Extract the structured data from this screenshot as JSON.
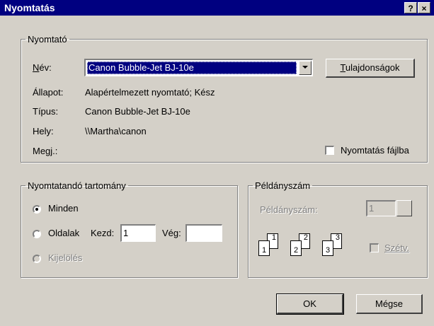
{
  "window": {
    "title": "Nyomtatás",
    "help_label": "?",
    "close_label": "×"
  },
  "printer": {
    "group_label": "Nyomtató",
    "name_label": "Név:",
    "name_value": "Canon Bubble-Jet BJ-10e",
    "properties_button": "Tulajdonságok",
    "status_label": "Állapot:",
    "status_value": "Alapértelmezett nyomtató; Kész",
    "type_label": "Típus:",
    "type_value": "Canon Bubble-Jet BJ-10e",
    "location_label": "Hely:",
    "location_value": "\\\\Martha\\canon",
    "comment_label": "Megj.:",
    "print_to_file_label": "Nyomtatás fájlba",
    "print_to_file_checked": false
  },
  "range": {
    "group_label": "Nyomtatandó tartomány",
    "all_label": "Minden",
    "pages_label": "Oldalak",
    "from_label": "Kezd:",
    "from_value": "1",
    "to_label": "Vég:",
    "to_value": "",
    "selection_label": "Kijelölés",
    "selected": "all"
  },
  "copies": {
    "group_label": "Példányszám",
    "count_label": "Példányszám:",
    "count_value": "1",
    "collate_label": "Szétv.",
    "collate_checked": false,
    "collate_icon_pages": [
      [
        "1",
        "1"
      ],
      [
        "2",
        "2"
      ],
      [
        "3",
        "3"
      ]
    ]
  },
  "buttons": {
    "ok": "OK",
    "cancel": "Mégse"
  },
  "colors": {
    "title_bar": "#000080",
    "face": "#d4d0c8",
    "selection": "#000080"
  }
}
